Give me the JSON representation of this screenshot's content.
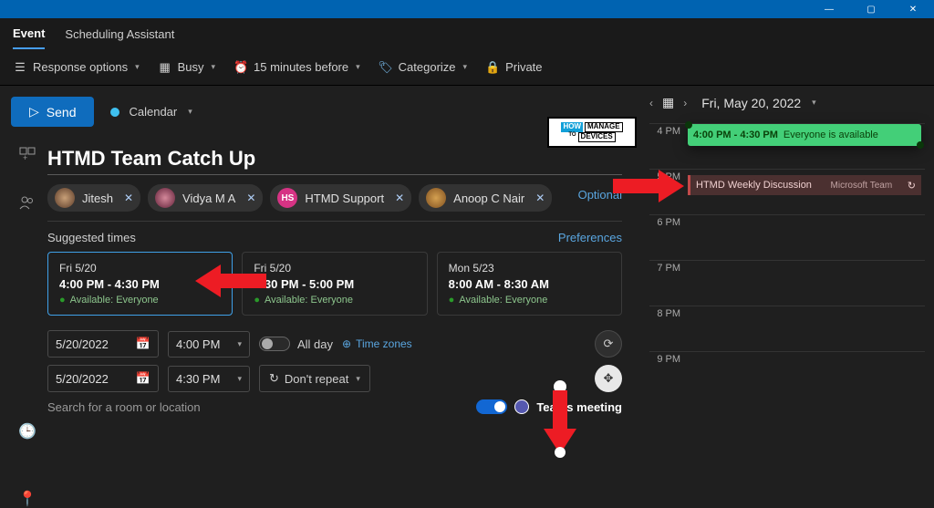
{
  "window": {
    "minimize": "—",
    "maximize": "▢",
    "close": "✕"
  },
  "tabs": {
    "event": "Event",
    "scheduling": "Scheduling Assistant"
  },
  "optbar": {
    "response": "Response options",
    "busy": "Busy",
    "reminder": "15 minutes before",
    "categorize": "Categorize",
    "private": "Private"
  },
  "send": {
    "label": "Send",
    "calendar": "Calendar"
  },
  "title": "HTMD Team Catch Up",
  "people": {
    "optional": "Optional",
    "list": [
      {
        "name": "Jitesh",
        "cls": "j"
      },
      {
        "name": "Vidya M A",
        "cls": "v"
      },
      {
        "name": "HTMD Support",
        "cls": "hs",
        "initials": "HS"
      },
      {
        "name": "Anoop C Nair",
        "cls": "a"
      }
    ]
  },
  "suggested": {
    "head": "Suggested times",
    "prefs": "Preferences",
    "cards": [
      {
        "date": "Fri 5/20",
        "time": "4:00 PM - 4:30 PM",
        "avail": "Available: Everyone"
      },
      {
        "date": "Fri 5/20",
        "time": "4:30 PM - 5:00 PM",
        "avail": "Available: Everyone"
      },
      {
        "date": "Mon 5/23",
        "time": "8:00 AM - 8:30 AM",
        "avail": "Available: Everyone"
      }
    ]
  },
  "datetime": {
    "startDate": "5/20/2022",
    "startTime": "4:00 PM",
    "endDate": "5/20/2022",
    "endTime": "4:30 PM",
    "allday": "All day",
    "tz": "Time zones",
    "repeat": "Don't repeat"
  },
  "location": {
    "placeholder": "Search for a room or location",
    "teams": "Teams meeting"
  },
  "rightcal": {
    "date": "Fri, May 20, 2022",
    "hours": [
      "4 PM",
      "5 PM",
      "6 PM",
      "7 PM",
      "8 PM",
      "9 PM"
    ],
    "avail": {
      "time": "4:00 PM - 4:30 PM",
      "text": "Everyone is available"
    },
    "event": {
      "title": "HTMD Weekly Discussion",
      "sub": "Microsoft Team"
    }
  },
  "badge": {
    "how": "HOW",
    "to": "TO",
    "manage": "MANAGE",
    "devices": "DEVICES"
  }
}
